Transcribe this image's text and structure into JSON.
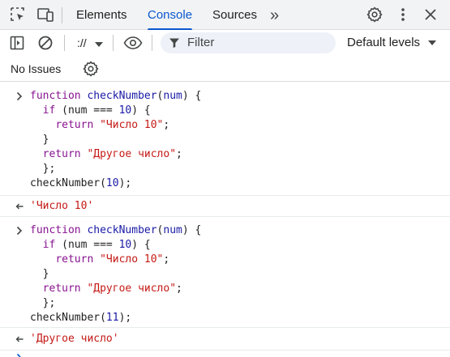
{
  "tabbar": {
    "tabs": [
      {
        "label": "Elements",
        "active": false
      },
      {
        "label": "Console",
        "active": true
      },
      {
        "label": "Sources",
        "active": false
      }
    ],
    "more_tabs_glyph": "»",
    "icons": [
      "select-element-icon",
      "device-toolbar-icon",
      "more-tabs-icon",
      "settings-gear-icon",
      "more-vert-icon",
      "close-icon"
    ]
  },
  "toolbar": {
    "context_selector": "://",
    "filter_placeholder": "Filter",
    "levels_label": "Default levels",
    "icons": [
      "sidebar-toggle-icon",
      "clear-console-icon",
      "context-dropdown-icon",
      "live-expression-eye-icon",
      "filter-funnel-icon",
      "levels-dropdown-icon"
    ]
  },
  "issues": {
    "label": "No Issues",
    "icon": "issues-settings-gear-icon"
  },
  "colors": {
    "accent": "#0b57d0",
    "keyword": "#881391",
    "function_name": "#1a1aa6",
    "string": "#c41a16",
    "number": "#1a1aa6"
  },
  "console": {
    "messages": [
      {
        "kind": "input",
        "lines": [
          "function checkNumber(num) {",
          "  if (num === 10) {",
          "    return \"Число 10\";",
          "  }",
          "  return \"Другое число\";",
          "  };",
          "checkNumber(10);"
        ]
      },
      {
        "kind": "output",
        "text": "'Число 10'"
      },
      {
        "kind": "input",
        "lines": [
          "function checkNumber(num) {",
          "  if (num === 10) {",
          "    return \"Число 10\";",
          "  }",
          "  return \"Другое число\";",
          "  };",
          "checkNumber(11);"
        ]
      },
      {
        "kind": "output",
        "text": "'Другое число'"
      }
    ]
  }
}
